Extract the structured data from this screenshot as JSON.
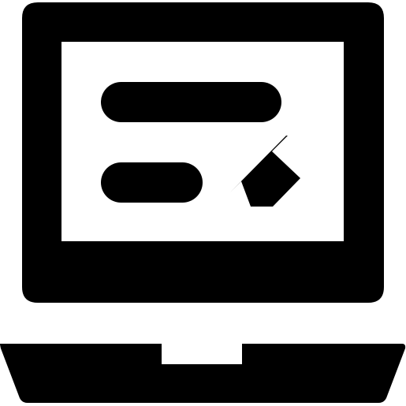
{
  "icon": {
    "name": "laptop-cursor-icon",
    "fill_color": "#000000",
    "background_color": "#ffffff"
  }
}
